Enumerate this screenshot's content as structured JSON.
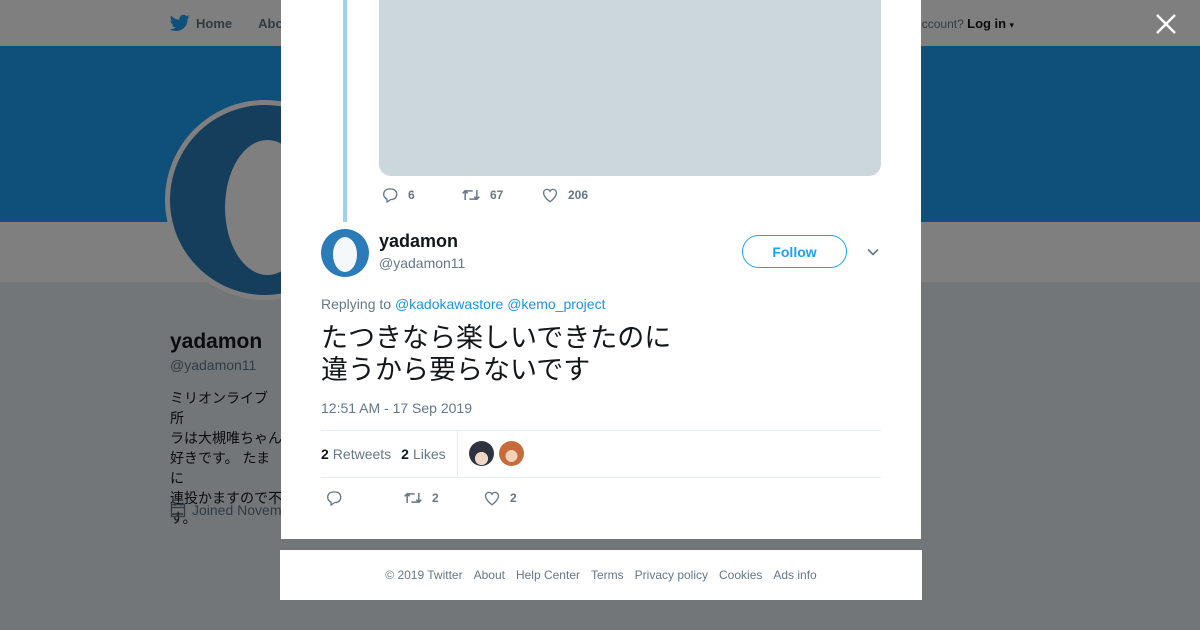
{
  "background": {
    "nav": {
      "home_label": "Home",
      "about_label": "Abo",
      "account_prompt": "ccount?",
      "login_label": "Log in"
    },
    "profile": {
      "name": "yadamon",
      "handle": "@yadamon11",
      "bio": "ミリオンライブ 所\nラは大槻唯ちゃん\n好きです。 たまに\n連投かますので不\nす。",
      "joined": "Joined Novem"
    },
    "colors": {
      "banner": "#1da1f2",
      "avatar": "#2b7bb9"
    }
  },
  "previous_tweet": {
    "replies": "6",
    "retweets": "67",
    "likes": "206"
  },
  "tweet": {
    "author_name": "yadamon",
    "author_handle": "@yadamon11",
    "follow_label": "Follow",
    "replying_prefix": "Replying to",
    "replying_to": [
      "@kadokawastore",
      "@kemo_project"
    ],
    "text": "たつきなら楽しいできたのに\n違うから要らないです",
    "timestamp": "12:51 AM - 17 Sep 2019",
    "stats": {
      "retweets_count": "2",
      "retweets_label": "Retweets",
      "likes_count": "2",
      "likes_label": "Likes"
    },
    "actions": {
      "retweets": "2",
      "likes": "2"
    }
  },
  "footer": {
    "copyright": "© 2019 Twitter",
    "links": [
      "About",
      "Help Center",
      "Terms",
      "Privacy policy",
      "Cookies",
      "Ads info"
    ]
  },
  "icons": {
    "twitter_bird": "twitter-bird-icon",
    "close": "close-icon",
    "reply": "reply-icon",
    "retweet": "retweet-icon",
    "like": "heart-icon",
    "caret": "chevron-down-icon",
    "calendar": "calendar-icon"
  }
}
